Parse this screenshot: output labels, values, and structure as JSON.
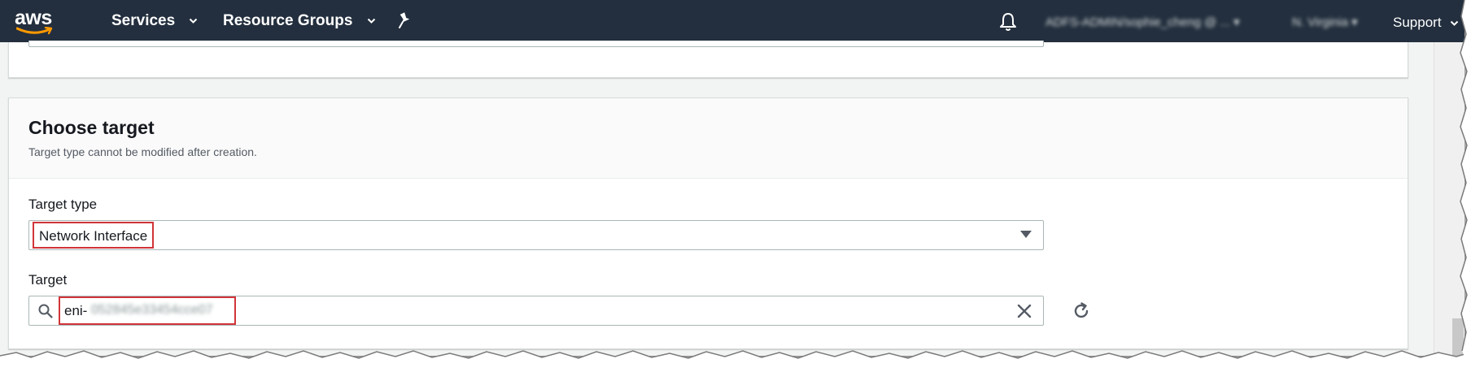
{
  "nav": {
    "logo": "aws",
    "services": "Services",
    "resource_groups": "Resource Groups",
    "account": "ADFS-ADMIN/sophie_cheng @ ...",
    "region": "N. Virginia",
    "support": "Support",
    "icons": [
      "pin-icon",
      "bell-icon",
      "chevron-down-icon"
    ]
  },
  "card": {
    "title": "Choose target",
    "description": "Target type cannot be modified after creation.",
    "target_type": {
      "label": "Target type",
      "value": "Network Interface"
    },
    "target": {
      "label": "Target",
      "value_prefix": "eni-",
      "value_redacted": "052845e33454cce07"
    }
  },
  "colors": {
    "nav_bg": "#232f3e",
    "highlight": "#d13438",
    "page_bg": "#f2f3f3"
  }
}
